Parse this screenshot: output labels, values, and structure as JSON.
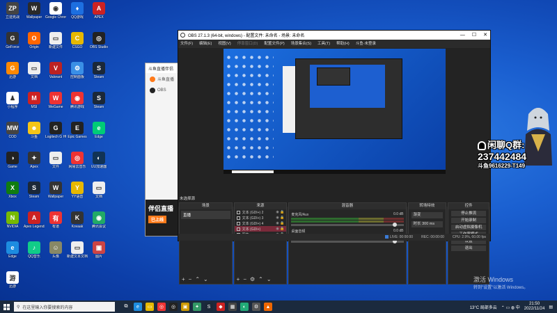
{
  "desktop": {
    "icons": [
      {
        "label": "立迪克战",
        "color": "#444",
        "glyph": "ZP"
      },
      {
        "label": "Wallpaper",
        "color": "#2a2a2a",
        "glyph": "W"
      },
      {
        "label": "Google Chrome",
        "color": "#fff",
        "glyph": "◉"
      },
      {
        "label": "QQ游戏",
        "color": "#1d6fe0",
        "glyph": "♦"
      },
      {
        "label": "APEX",
        "color": "#c22",
        "glyph": "A"
      },
      {
        "label": "GeForce",
        "color": "#333",
        "glyph": "G"
      },
      {
        "label": "Origin",
        "color": "#f60",
        "glyph": "O"
      },
      {
        "label": "新建文件",
        "color": "#eee",
        "glyph": "▭"
      },
      {
        "label": "CSGO",
        "color": "#e6b800",
        "glyph": "C"
      },
      {
        "label": "OBS Studio",
        "color": "#222",
        "glyph": "◎"
      },
      {
        "label": "迅游",
        "color": "#f80",
        "glyph": "G"
      },
      {
        "label": "文档",
        "color": "#eee",
        "glyph": "▭"
      },
      {
        "label": "Valorant",
        "color": "#b22",
        "glyph": "V"
      },
      {
        "label": "控制面板",
        "color": "#3a8fe6",
        "glyph": "⚙"
      },
      {
        "label": "Steam",
        "color": "#1b2838",
        "glyph": "S"
      },
      {
        "label": "小程序",
        "color": "#fff",
        "glyph": "♟"
      },
      {
        "label": "MSI",
        "color": "#c22",
        "glyph": "M"
      },
      {
        "label": "WeGame",
        "color": "#e33",
        "glyph": "W"
      },
      {
        "label": "腾讯游戏",
        "color": "#e33",
        "glyph": "◉"
      },
      {
        "label": "Steam",
        "color": "#1b2838",
        "glyph": "S"
      },
      {
        "label": "COD",
        "color": "#444",
        "glyph": "MW"
      },
      {
        "label": "斗鱼",
        "color": "#f5c518",
        "glyph": "☻"
      },
      {
        "label": "Logitech G HUB",
        "color": "#222",
        "glyph": "G"
      },
      {
        "label": "Epic Games",
        "color": "#222",
        "glyph": "E"
      },
      {
        "label": "Edge",
        "color": "#0c7",
        "glyph": "e"
      },
      {
        "label": "Game",
        "color": "#222",
        "glyph": "◑"
      },
      {
        "label": "Apex",
        "color": "#333",
        "glyph": "✦"
      },
      {
        "label": "文件",
        "color": "#eee",
        "glyph": "▭"
      },
      {
        "label": "网易云音乐",
        "color": "#e33",
        "glyph": "◎"
      },
      {
        "label": "UU加速器",
        "color": "#135",
        "glyph": "◐"
      },
      {
        "label": "Xbox",
        "color": "#107c10",
        "glyph": "X"
      },
      {
        "label": "Steam",
        "color": "#1b2838",
        "glyph": "S"
      },
      {
        "label": "Wallpaper",
        "color": "#333",
        "glyph": "W"
      },
      {
        "label": "YY语音",
        "color": "#e6b800",
        "glyph": "Y"
      },
      {
        "label": "文档",
        "color": "#eee",
        "glyph": "▭"
      },
      {
        "label": "NVIDIA",
        "color": "#76b900",
        "glyph": "N"
      },
      {
        "label": "Apex Legends",
        "color": "#c22",
        "glyph": "A"
      },
      {
        "label": "有道",
        "color": "#e33",
        "glyph": "有"
      },
      {
        "label": "Kovaak",
        "color": "#333",
        "glyph": "K"
      },
      {
        "label": "腾讯会议",
        "color": "#2a6",
        "glyph": "◉"
      },
      {
        "label": "Edge",
        "color": "#1d8ce0",
        "glyph": "e"
      },
      {
        "label": "QQ音乐",
        "color": "#1c8",
        "glyph": "♪"
      },
      {
        "label": "头像",
        "color": "#886",
        "glyph": "☺"
      },
      {
        "label": "新建文本文档",
        "color": "#eee",
        "glyph": "▭"
      },
      {
        "label": "图片",
        "color": "#c44",
        "glyph": "▣"
      },
      {
        "label": "迅游",
        "color": "#fff",
        "glyph": "游"
      }
    ]
  },
  "bg_window": {
    "title": "斗鱼直播伴侣",
    "items": [
      "斗鱼直播",
      "OBS"
    ],
    "ad_title": "伴侣直播",
    "ad_sub": "已上线"
  },
  "obs": {
    "title": "OBS 27.1.3 (64-bit, windows) - 配置文件: 未命名 - 场景: 未命名",
    "menu": [
      "文件(F)",
      "编辑(E)",
      "视图(V)",
      "停靠窗口(D)",
      "配置文件(P)",
      "场景集合(S)",
      "工具(T)",
      "帮助(H)",
      "斗鱼-未登录"
    ],
    "dock_label": "未选择源",
    "scenes": {
      "title": "场景",
      "items": [
        "直播"
      ]
    },
    "sources": {
      "title": "来源",
      "items": [
        "文本 (GDI+) 2",
        "文本 (GDI+) 3",
        "文本 (GDI+) 4",
        "文本 (GDI+)",
        "图像"
      ]
    },
    "mixer": {
      "title": "混音器",
      "channels": [
        {
          "name": "麦克风/Aux",
          "db": "0.0 dB"
        },
        {
          "name": "桌面音频",
          "db": "0.0 dB"
        }
      ]
    },
    "transitions": {
      "title": "转场特效",
      "selected": "渐变",
      "duration_label": "时长",
      "duration": "300 ms"
    },
    "controls": {
      "title": "控件",
      "buttons": [
        "停止推流",
        "开始录制",
        "启动虚拟摄像机",
        "工作室模式",
        "设置",
        "退出"
      ]
    },
    "status": {
      "live": "LIVE: 00:00:00",
      "rec": "REC: 00:00:00",
      "cpu": "CPU: 2.9%, 60.00 fps"
    }
  },
  "overlay": {
    "line1": "闲聊Q群:",
    "line2": "237442484",
    "line3": "斗鱼9616229-T149"
  },
  "watermark": {
    "line1": "激活 Windows",
    "line2": "转到\"设置\"以激活 Windows。"
  },
  "taskbar": {
    "search_placeholder": "在这里输入你要搜索的内容",
    "apps": [
      {
        "name": "task-view",
        "glyph": "⧉",
        "color": "transparent"
      },
      {
        "name": "edge",
        "glyph": "e",
        "color": "#1d8ce0"
      },
      {
        "name": "explorer",
        "glyph": "▭",
        "color": "#e6b800"
      },
      {
        "name": "netease-music",
        "glyph": "◎",
        "color": "#e33"
      },
      {
        "name": "obs",
        "glyph": "◎",
        "color": "#222"
      },
      {
        "name": "game",
        "glyph": "▣",
        "color": "#c90"
      },
      {
        "name": "app",
        "glyph": "✦",
        "color": "#396"
      },
      {
        "name": "steam",
        "glyph": "S",
        "color": "#1b2838"
      },
      {
        "name": "app2",
        "glyph": "◆",
        "color": "#c22"
      },
      {
        "name": "app3",
        "glyph": "▦",
        "color": "#444"
      },
      {
        "name": "app4",
        "glyph": "◐",
        "color": "#2a7"
      },
      {
        "name": "app5",
        "glyph": "⚙",
        "color": "#555"
      },
      {
        "name": "app6",
        "glyph": "▲",
        "color": "#e60"
      }
    ],
    "weather": "13°C 局部多云",
    "time": "21:50",
    "date": "2022/11/24"
  }
}
